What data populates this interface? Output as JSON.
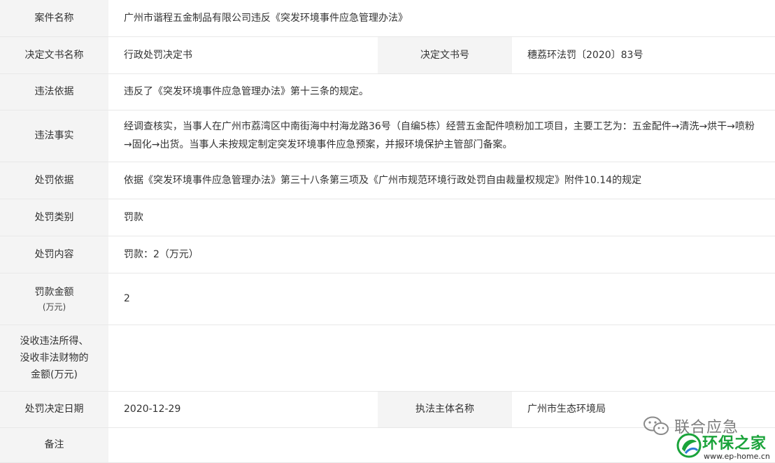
{
  "rows": {
    "case_name": {
      "label": "案件名称",
      "value": "广州市谐程五金制品有限公司违反《突发环境事件应急管理办法》"
    },
    "doc_name": {
      "label": "决定文书名称",
      "value": "行政处罚决定书"
    },
    "doc_no": {
      "label": "决定文书号",
      "value": "穗荔环法罚〔2020〕83号"
    },
    "basis": {
      "label": "违法依据",
      "value": "违反了《突发环境事件应急管理办法》第十三条的规定。"
    },
    "facts": {
      "label": "违法事实",
      "value": "经调查核实，当事人在广州市荔湾区中南街海中村海龙路36号（自编5栋）经营五金配件喷粉加工项目，主要工艺为：五金配件→清洗→烘干→喷粉→固化→出货。当事人未按规定制定突发环境事件应急预案，并报环境保护主管部门备案。"
    },
    "penalty_basis": {
      "label": "处罚依据",
      "value": "依据《突发环境事件应急管理办法》第三十八条第三项及《广州市规范环境行政处罚自由裁量权规定》附件10.14的规定"
    },
    "penalty_type": {
      "label": "处罚类别",
      "value": "罚款"
    },
    "penalty_content": {
      "label": "处罚内容",
      "value": "罚款：2（万元）"
    },
    "fine": {
      "label": "罚款金额",
      "label_sub": "(万元)",
      "value": "2"
    },
    "confiscation": {
      "label_lines": [
        "没收违法所得、",
        "没收非法财物的",
        "金额(万元)"
      ],
      "value": ""
    },
    "decision_date": {
      "label": "处罚决定日期",
      "value": "2020-12-29"
    },
    "authority": {
      "label": "执法主体名称",
      "value": "广州市生态环境局"
    },
    "remarks": {
      "label": "备注",
      "value": ""
    }
  },
  "watermarks": {
    "wechat_name": "联合应急",
    "brand_name": "环保之家",
    "brand_url": "www.ep-home.cn",
    "wechat_icon": "wechat-icon",
    "brand_logo": "ep-home-logo-icon",
    "colors": {
      "brand_green": "#1aa33a",
      "label_bg": "#f4f4f4",
      "border": "#e8e8e8"
    }
  }
}
